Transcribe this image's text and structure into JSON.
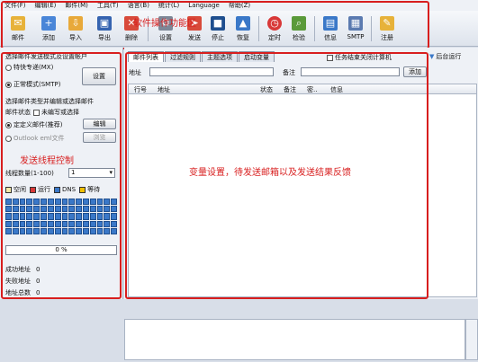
{
  "menu": [
    "文件(F)",
    "编辑(E)",
    "邮件(M)",
    "工具(T)",
    "语言(B)",
    "统计(L)",
    "Language",
    "帮助(Z)"
  ],
  "toolbar": {
    "items": [
      "邮件",
      "添加",
      "导入",
      "导出",
      "删除",
      "设置",
      "发送",
      "停止",
      "恢复",
      "定时",
      "检验",
      "信息",
      "SMTP",
      "注册"
    ],
    "annotation": "软件操作功能区"
  },
  "left": {
    "title": "选择邮件发送模式及设置帐户",
    "mode_special": "特快专递(MX)",
    "mode_normal": "正常模式(SMTP)",
    "settings_button": "设置",
    "select_type": "选择邮件类型并编辑或选择邮件",
    "mail_status_label": "邮件状态",
    "mail_status_value": "未编写或选择",
    "custom_mail": "定定义邮件(推荐)",
    "edit_button": "编辑",
    "outlook_file": "Outlook eml文件",
    "browse_button": "浏览",
    "thread_annotation": "发送线程控制",
    "thread_label": "线程数量(1-100)",
    "thread_value": "1",
    "legend": [
      {
        "label": "空闲",
        "color": "#f6e9a8"
      },
      {
        "label": "运行",
        "color": "#d83838"
      },
      {
        "label": "DNS",
        "color": "#3a78c8"
      },
      {
        "label": "等待",
        "color": "#f0c000"
      }
    ],
    "progress": "0 %",
    "success_label": "成功地址",
    "success_value": "0",
    "fail_label": "失败地址",
    "fail_value": "0",
    "total_label": "地址总数",
    "total_value": "0"
  },
  "main": {
    "tabs": [
      "邮件列表",
      "过滤规则",
      "主题选项",
      "启动变量"
    ],
    "shutdown_label": "任务结束关闭计算机",
    "background_label": "后台运行",
    "address_label": "地址",
    "remark_label": "备注",
    "add_button": "添加",
    "columns": [
      "行号",
      "地址",
      "状态",
      "备注",
      "密..",
      "信息"
    ],
    "annotation": "变量设置，待发送邮箱以及发送结果反馈"
  }
}
